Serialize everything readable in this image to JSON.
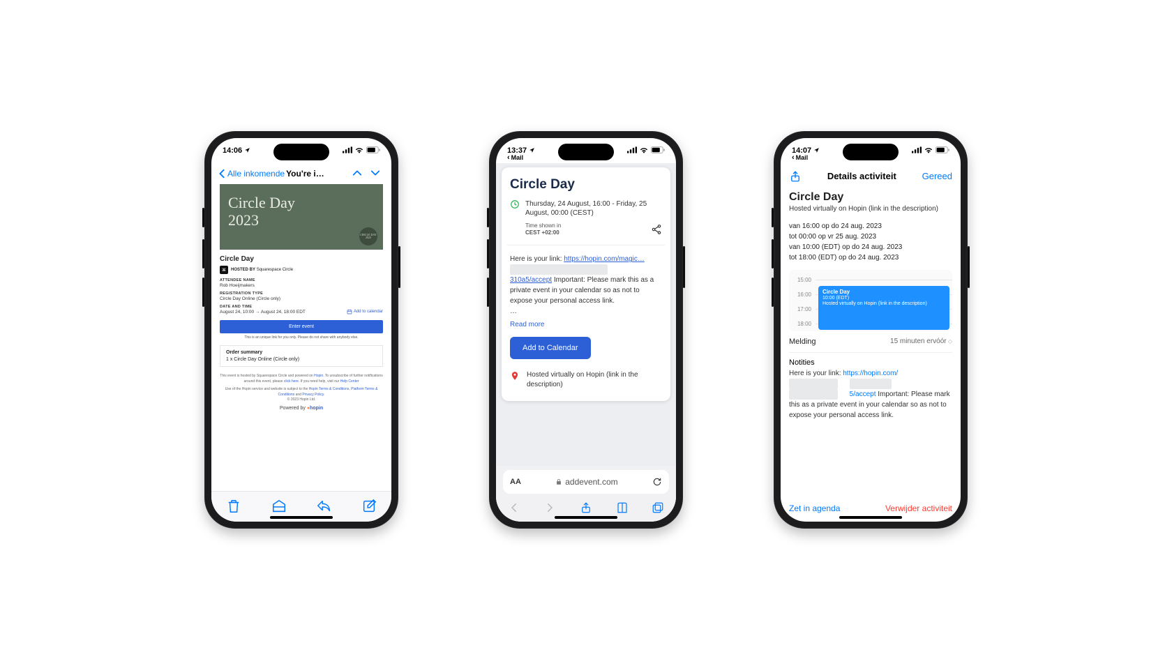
{
  "phone1": {
    "status_time": "14:06",
    "nav_back": "Alle inkomende",
    "nav_title": "You're i…",
    "hero_title_l1": "Circle Day",
    "hero_title_l2": "2023",
    "hero_badge": "CIRCLE DAY 2023",
    "event_name": "Circle Day",
    "hosted_label": "HOSTED BY",
    "hosted_by": "Squarespace Circle",
    "attendee_label": "ATTENDEE NAME",
    "attendee": "Rob Hoeijmakers",
    "reg_label": "REGISTRATION TYPE",
    "reg": "Circle Day Online (Circle only)",
    "dt_label": "DATE AND TIME",
    "dt": "August 24, 10:00 → August 24, 18:00 EDT",
    "add_cal": "Add to calendar",
    "enter": "Enter event",
    "unique": "This is an unique link for you only. Please do not share with anybody else.",
    "order_title": "Order summary",
    "order_line": "1 x Circle Day Online (Circle only)",
    "foot1_a": "This event is hosted by Squarespace Circle and powered on ",
    "foot1_hopin": "Hopin",
    "foot1_b": ". To unsubscribe of further notifications around this event, please ",
    "foot1_click": "click here",
    "foot1_c": ". If you need help, visit our ",
    "foot1_help": "Help Center",
    "foot2_a": "Use of the Hopin service and website is subject to the ",
    "foot2_tc": "Hopin Terms & Conditions",
    "foot2_b": ", ",
    "foot2_pt": "Platform Terms & Conditions",
    "foot2_c": " and ",
    "foot2_pp": "Privacy Policy",
    "foot2_d": ".",
    "foot3": "© 2023 Hopin Ltd.",
    "powered_a": "Powered by ",
    "powered_b": "hopin"
  },
  "phone2": {
    "status_time": "13:37",
    "mini_back": "Mail",
    "title": "Circle Day",
    "datetime": "Thursday, 24 August, 16:00 - Friday, 25 August, 00:00 (CEST)",
    "tz_label": "Time shown in",
    "tz": "CEST +02:00",
    "desc_a": "Here is your link: ",
    "link1": "https://hopin.com/magic…",
    "link2": "310a5/accept",
    "desc_b": " Important: Please mark this as a private event in your calendar so as not to expose your personal access link.",
    "ellipsis": "…",
    "read_more": "Read more",
    "add_btn": "Add to Calendar",
    "location": "Hosted virtually on Hopin (link in the description)",
    "url_host": "addevent.com",
    "aa": "AA"
  },
  "phone3": {
    "status_time": "14:07",
    "mini_back": "Mail",
    "header_title": "Details activiteit",
    "header_done": "Gereed",
    "title": "Circle Day",
    "subtitle": "Hosted virtually on Hopin (link in the description)",
    "d1": "van 16:00 op do 24 aug. 2023",
    "d2": "tot 00:00 op vr 25 aug. 2023",
    "d3": "van 10:00 (EDT) op do 24 aug. 2023",
    "d4": "tot 18:00 (EDT) op do 24 aug. 2023",
    "hours": [
      "15:00",
      "16:00",
      "17:00",
      "18:00"
    ],
    "tl_title": "Circle Day",
    "tl_time": "10:00 (EDT)",
    "tl_loc": "Hosted virtually on Hopin (link in the description)",
    "alert_label": "Melding",
    "alert_value": "15 minuten ervóór",
    "notes_label": "Notities",
    "notes_a": "Here is your link: ",
    "notes_link1": "https://hopin.com/",
    "notes_link2": "5/accept",
    "notes_b": " Important: Please mark this as a private event in your calendar so as not to expose your personal access link.",
    "action_add": "Zet in agenda",
    "action_del": "Verwijder activiteit"
  }
}
